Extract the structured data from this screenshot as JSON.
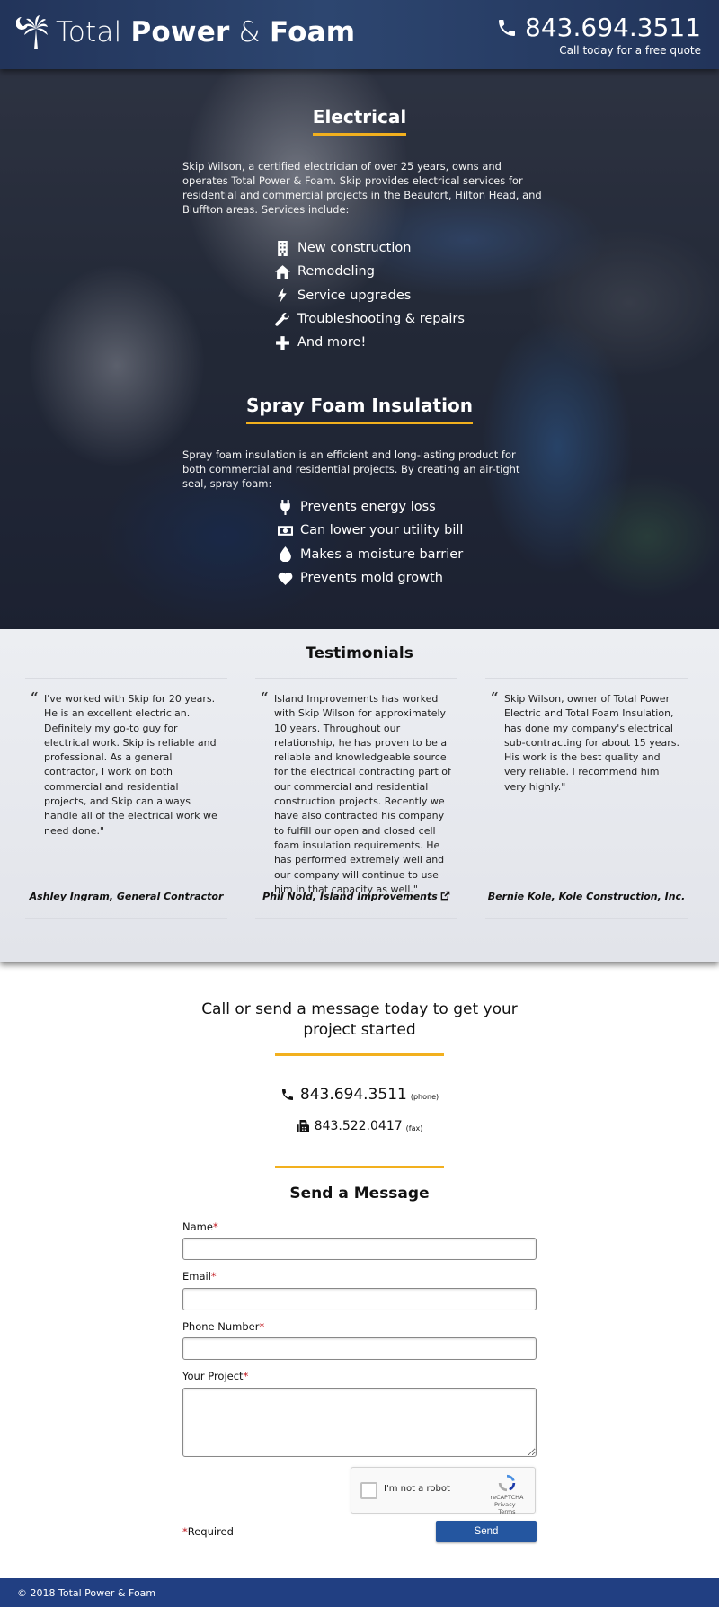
{
  "header": {
    "brand_light": "Total",
    "brand_bold1": "Power",
    "brand_amp": "&",
    "brand_bold2": "Foam",
    "phone": "843.694.3511",
    "phone_sub": "Call today for a free quote"
  },
  "electrical": {
    "title": "Electrical",
    "text": "Skip Wilson, a certified electrician of over 25 years, owns and operates Total Power & Foam. Skip provides electrical services for residential and commercial projects in the Beaufort, Hilton Head, and Bluffton areas. Services include:",
    "items": [
      {
        "icon": "building-icon",
        "label": "New construction"
      },
      {
        "icon": "home-icon",
        "label": "Remodeling"
      },
      {
        "icon": "bolt-icon",
        "label": "Service upgrades"
      },
      {
        "icon": "wrench-icon",
        "label": "Troubleshooting & repairs"
      },
      {
        "icon": "plus-icon",
        "label": "And more!"
      }
    ]
  },
  "foam": {
    "title": "Spray Foam Insulation",
    "text": "Spray foam insulation is an efficient and long-lasting product for both commercial and residential projects. By creating an air-tight seal, spray foam:",
    "items": [
      {
        "icon": "plug-icon",
        "label": "Prevents energy loss"
      },
      {
        "icon": "money-icon",
        "label": "Can lower your utility bill"
      },
      {
        "icon": "droplet-icon",
        "label": "Makes a moisture barrier"
      },
      {
        "icon": "heart-icon",
        "label": "Prevents mold growth"
      }
    ]
  },
  "testimonials": {
    "title": "Testimonials",
    "quote_mark": "“",
    "items": [
      {
        "text": "I've worked with Skip for 20 years. He is an excellent electrician. Definitely my go-to guy for electrical work. Skip is reliable and professional. As a general contractor, I work on both commercial and residential projects, and Skip can always handle all of the electrical work we need done.\"",
        "author": "Ashley Ingram, General Contractor"
      },
      {
        "text": "Island Improvements has worked with Skip Wilson for approximately 10 years. Throughout our relationship, he has proven to be a reliable and knowledgeable source for the electrical contracting part of our commercial and residential construction projects. Recently we have also contracted his company to fulfill our open and closed cell foam insulation requirements. He has performed extremely well and our company will continue to use him in that capacity as well.\"",
        "author": "Phil Nold, Island Improvements"
      },
      {
        "text": "Skip Wilson, owner of Total Power Electric and Total Foam Insulation, has done my company's electrical sub-contracting for about 15 years. His work is the best quality and very reliable. I recommend him very highly.\"",
        "author": "Bernie Kole, Kole Construction, Inc."
      }
    ]
  },
  "contact": {
    "heading": "Call or send a message today to get your project started",
    "phone": "843.694.3511",
    "phone_tag": "(phone)",
    "fax": "843.522.0417",
    "fax_tag": "(fax)",
    "form_title": "Send a Message",
    "fields": {
      "name": "Name",
      "email": "Email",
      "phone": "Phone Number",
      "project": "Your Project"
    },
    "required_mark": "*",
    "required_note": "Required",
    "captcha_label": "I'm not a robot",
    "captcha_brand": "reCAPTCHA",
    "captcha_links": "Privacy - Terms",
    "send": "Send"
  },
  "footer": {
    "text": "© 2018 Total Power & Foam"
  },
  "colors": {
    "accent": "#f2b01e",
    "header": "#2d4670",
    "button": "#2456a0",
    "footer": "#213f82",
    "required": "#c0141b"
  }
}
